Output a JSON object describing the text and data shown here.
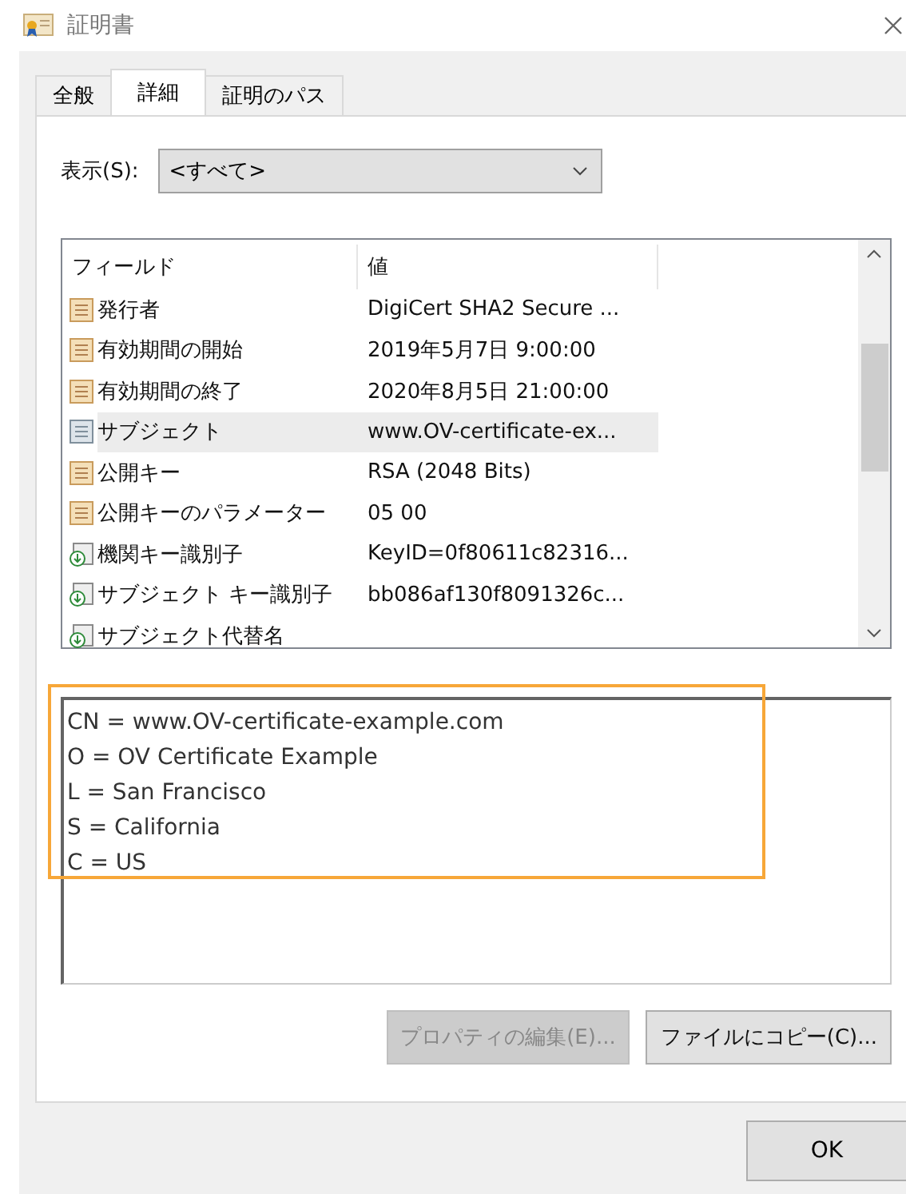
{
  "window": {
    "title": "証明書"
  },
  "tabs": [
    {
      "label": "全般",
      "selected": false
    },
    {
      "label": "詳細",
      "selected": true
    },
    {
      "label": "証明のパス",
      "selected": false
    }
  ],
  "show": {
    "label": "表示(S):",
    "value": "<すべて>"
  },
  "table": {
    "columns": [
      "フィールド",
      "値"
    ],
    "rows": [
      {
        "kind": "property",
        "field": "発行者",
        "value": "DigiCert SHA2 Secure ...",
        "selected": false
      },
      {
        "kind": "property",
        "field": "有効期間の開始",
        "value": "2019年5月7日 9:00:00",
        "selected": false
      },
      {
        "kind": "property",
        "field": "有効期間の終了",
        "value": "2020年8月5日 21:00:00",
        "selected": false
      },
      {
        "kind": "subject",
        "field": "サブジェクト",
        "value": "www.OV-certificate-ex...",
        "selected": true
      },
      {
        "kind": "property",
        "field": "公開キー",
        "value": "RSA (2048 Bits)",
        "selected": false
      },
      {
        "kind": "property",
        "field": "公開キーのパラメーター",
        "value": "05 00",
        "selected": false
      },
      {
        "kind": "extension",
        "field": "機関キー識別子",
        "value": "KeyID=0f80611c82316...",
        "selected": false
      },
      {
        "kind": "extension",
        "field": "サブジェクト キー識別子",
        "value": "bb086af130f8091326c...",
        "selected": false
      },
      {
        "kind": "extension",
        "field": "サブジェクト代替名",
        "selected": false
      }
    ]
  },
  "detail": {
    "lines": [
      "CN = www.OV-certificate-example.com",
      "O = OV Certificate Example",
      "L = San Francisco",
      "S = California",
      "C = US"
    ],
    "highlighted": true
  },
  "buttons": [
    {
      "label": "プロパティの編集(E)...",
      "disabled": true
    },
    {
      "label": "ファイルにコピー(C)...",
      "disabled": false
    }
  ],
  "ok": {
    "label": "OK"
  }
}
